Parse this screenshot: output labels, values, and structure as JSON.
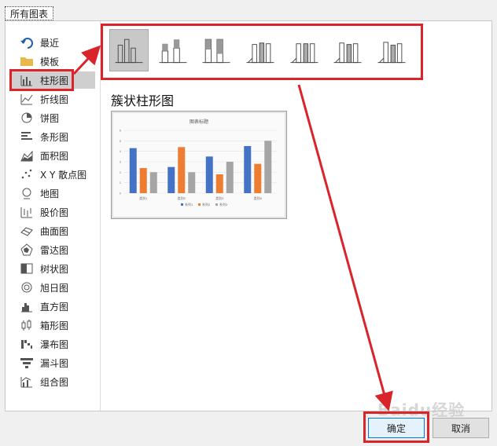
{
  "tab": {
    "label": "所有图表"
  },
  "sidebar": {
    "items": [
      {
        "label": "最近",
        "icon": "undo-arrow-icon"
      },
      {
        "label": "模板",
        "icon": "folder-icon"
      },
      {
        "label": "柱形图",
        "icon": "column-chart-icon",
        "selected": true
      },
      {
        "label": "折线图",
        "icon": "line-chart-icon"
      },
      {
        "label": "饼图",
        "icon": "pie-chart-icon"
      },
      {
        "label": "条形图",
        "icon": "bar-chart-icon"
      },
      {
        "label": "面积图",
        "icon": "area-chart-icon"
      },
      {
        "label": "X Y 散点图",
        "icon": "scatter-chart-icon"
      },
      {
        "label": "地图",
        "icon": "map-chart-icon"
      },
      {
        "label": "股价图",
        "icon": "stock-chart-icon"
      },
      {
        "label": "曲面图",
        "icon": "surface-chart-icon"
      },
      {
        "label": "雷达图",
        "icon": "radar-chart-icon"
      },
      {
        "label": "树状图",
        "icon": "treemap-chart-icon"
      },
      {
        "label": "旭日图",
        "icon": "sunburst-chart-icon"
      },
      {
        "label": "直方图",
        "icon": "histogram-chart-icon"
      },
      {
        "label": "箱形图",
        "icon": "box-whisker-chart-icon"
      },
      {
        "label": "瀑布图",
        "icon": "waterfall-chart-icon"
      },
      {
        "label": "漏斗图",
        "icon": "funnel-chart-icon"
      },
      {
        "label": "组合图",
        "icon": "combo-chart-icon"
      }
    ]
  },
  "subtypes": [
    {
      "icon": "clustered-column-icon",
      "selected": true
    },
    {
      "icon": "stacked-column-icon"
    },
    {
      "icon": "100-stacked-column-icon"
    },
    {
      "icon": "3d-clustered-column-icon"
    },
    {
      "icon": "3d-stacked-column-icon"
    },
    {
      "icon": "3d-100-stacked-column-icon"
    },
    {
      "icon": "3d-column-icon"
    }
  ],
  "main": {
    "heading": "簇状柱形图"
  },
  "chart_data": {
    "type": "bar",
    "title": "图表标题",
    "categories": [
      "类别1",
      "类别2",
      "类别3",
      "类别4"
    ],
    "series": [
      {
        "name": "系列1",
        "values": [
          4.3,
          2.5,
          3.5,
          4.5
        ],
        "color": "#4472c4"
      },
      {
        "name": "系列2",
        "values": [
          2.4,
          4.4,
          1.8,
          2.8
        ],
        "color": "#ed7d31"
      },
      {
        "name": "系列3",
        "values": [
          2.0,
          2.0,
          3.0,
          5.0
        ],
        "color": "#a5a5a5"
      }
    ],
    "ylim": [
      0,
      6
    ],
    "yticks": [
      "0",
      "1",
      "2",
      "3",
      "4",
      "5",
      "6"
    ],
    "grid": true,
    "legend": "bottom"
  },
  "buttons": {
    "ok": "确定",
    "cancel": "取消"
  },
  "watermark": "Baidu经验",
  "colors": {
    "highlight": "#d9252a",
    "selection": "#cfcfcf"
  }
}
